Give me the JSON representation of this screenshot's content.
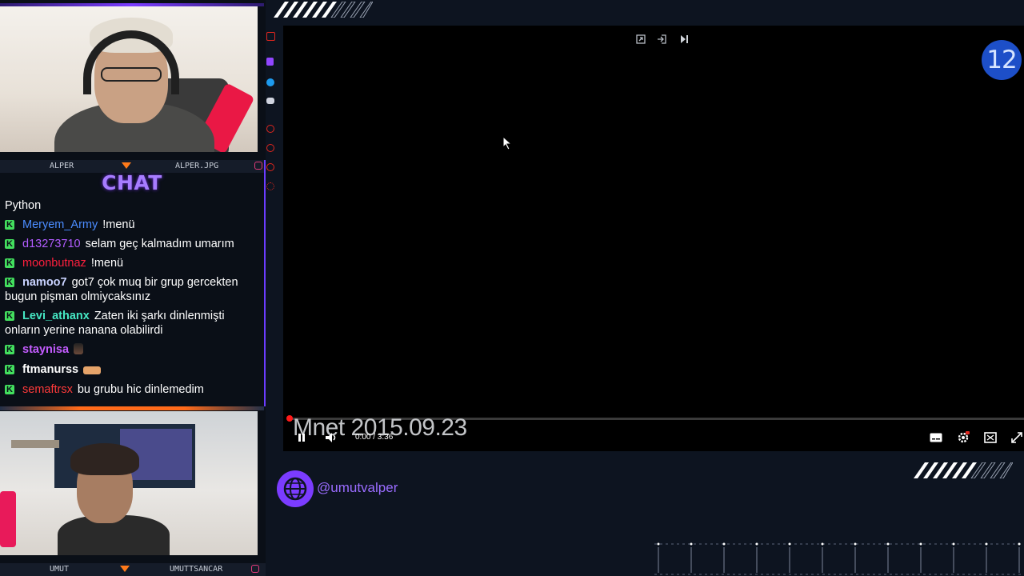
{
  "webcams": {
    "top": {
      "name_left": "ALPER",
      "name_right": "ALPER.JPG"
    },
    "bottom": {
      "name_left": "UMUT",
      "name_right": "UMUTTSANCAR"
    }
  },
  "chat": {
    "title": "CHAT",
    "first_line": "Python",
    "messages": [
      {
        "user": "Meryem_Army",
        "user_color": "#4b8cff",
        "text": "!menü"
      },
      {
        "user": "d13273710",
        "user_color": "#b25cff",
        "text": "selam geç kalmadım umarım"
      },
      {
        "user": "moonbutnaz",
        "user_color": "#ff1f3d",
        "text": "!menü"
      },
      {
        "user": "namoo7",
        "user_color": "#c9d3ff",
        "text": "got7 çok muq bir grup gercekten bugun pişman olmiycaksınız"
      },
      {
        "user": "Levi_athanx",
        "user_color": "#46e8c4",
        "text": "Zaten iki şarkı dinlenmişti onların yerine nanana olabilirdi"
      },
      {
        "user": "staynisa",
        "user_color": "#c45cff",
        "text": ""
      },
      {
        "user": "ftmanurss",
        "user_color": "#ffffff",
        "text": ""
      },
      {
        "user": "semaftrsx",
        "user_color": "#ff3a3a",
        "text": "bu grubu hic dinlemedim"
      }
    ],
    "badge_letter": "K"
  },
  "player": {
    "video_title": "Mnet 2015.09.23",
    "time": "0:00 / 3:36",
    "progress": 0.0
  },
  "overlay": {
    "badge_number": "12",
    "social_handle": "@umutvalper"
  },
  "colors": {
    "accent_purple": "#7b3cff",
    "accent_orange": "#ff7a1a",
    "chat_badge": "#43e05e",
    "number_badge": "#1d4fc8"
  }
}
